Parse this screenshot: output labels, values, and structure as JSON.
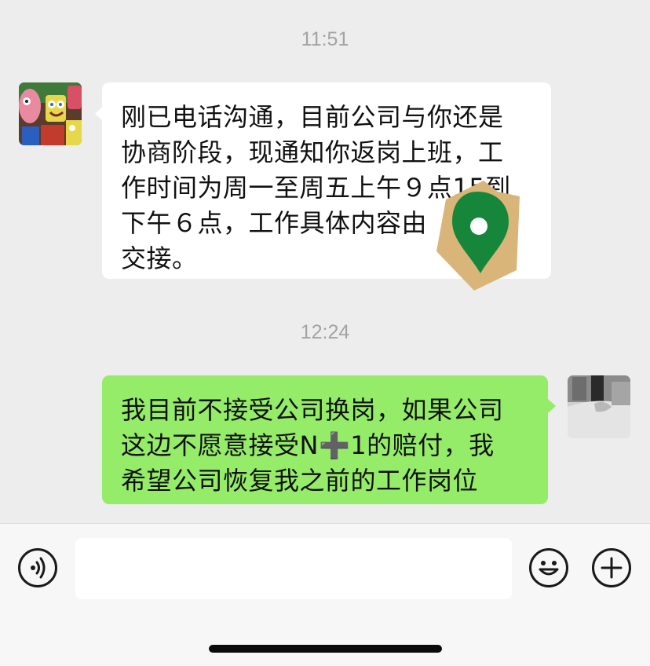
{
  "messages": [
    {
      "timestamp": "11:51",
      "direction": "incoming",
      "lines": [
        "刚已电话沟通，目前公司与你还是",
        "协商阶段，现通知你返岗上班，工",
        "作时间为周一至周五上午９点15到",
        "下午６点，工作具体内容由",
        "交接。"
      ]
    },
    {
      "timestamp": "12:24",
      "direction": "outgoing",
      "lines": [
        "我目前不接受公司换岗，如果公司",
        "这边不愿意接受N➕1的赔付，我",
        "希望公司恢复我之前的工作岗位"
      ]
    }
  ],
  "composer": {
    "placeholder": ""
  },
  "icons": {
    "voice": "voice-input-icon",
    "emoji": "emoji-icon",
    "more": "plus-icon",
    "location_sticker": "location-pin-icon"
  },
  "colors": {
    "background": "#ededed",
    "incoming_bubble": "#ffffff",
    "outgoing_bubble": "#95ec69",
    "timestamp": "#a3a3a3",
    "pin": "#16873a",
    "sticker_paper": "#d9b57a"
  }
}
